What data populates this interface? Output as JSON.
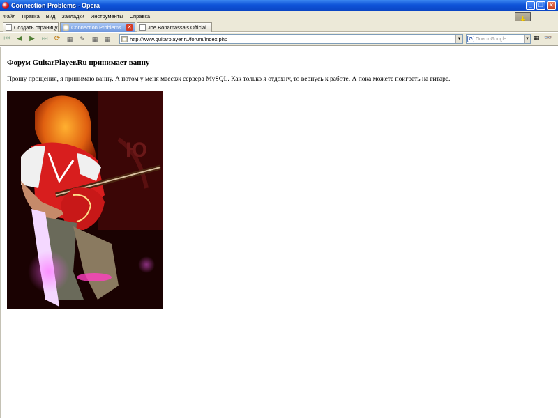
{
  "window": {
    "title": "Connection Problems - Opera"
  },
  "menu": [
    "Файл",
    "Правка",
    "Вид",
    "Закладки",
    "Инструменты",
    "Справка"
  ],
  "tabs": [
    {
      "label": "Создать страницу",
      "active": false,
      "icon": "page-icon"
    },
    {
      "label": "Connection Problems",
      "active": true,
      "icon": "cloud-icon"
    },
    {
      "label": "Joe Bonamassa's Official ...",
      "active": false,
      "icon": "page-icon"
    }
  ],
  "address": {
    "url": "http://www.guitarplayer.ru/forum/index.php"
  },
  "search": {
    "placeholder": "Поиск Google"
  },
  "page": {
    "heading": "Форум GuitarPlayer.Ru принимает ванну",
    "text": "Прошу прощения, я принимаю ванну. А потом у меня массаж сервера MySQL. Как только я отдохну, то вернусь к работе. А пока можете поиграть на гитаре."
  },
  "colors": {
    "titlebar": "#0e53d8",
    "chrome": "#ece9d8",
    "active_tab": "#6f97dd",
    "close": "#c8411f"
  }
}
